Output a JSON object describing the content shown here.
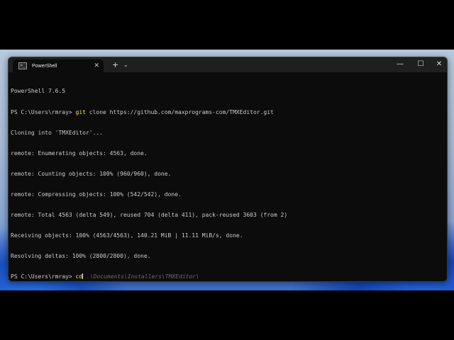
{
  "window": {
    "tab_title": "PowerShell",
    "tab_icon_glyph": ">_",
    "tab_close_glyph": "✕",
    "new_tab_glyph": "+",
    "dropdown_glyph": "⌄",
    "minimize_glyph": "—",
    "maximize_glyph": "☐",
    "close_glyph": "✕"
  },
  "terminal": {
    "banner": "PowerShell 7.6.5",
    "prompt": "PS C:\\Users\\rmray> ",
    "clone_cmd": "git",
    "clone_args": " clone https://github.com/maxprograms-com/TMXEditor.git",
    "output": [
      "Cloning into 'TMXEditor'...",
      "remote: Enumerating objects: 4563, done.",
      "remote: Counting objects: 100% (960/960), done.",
      "remote: Compressing objects: 100% (542/542), done.",
      "remote: Total 4563 (delta 549), reused 704 (delta 411), pack-reused 3603 (from 2)",
      "Receiving objects: 100% (4563/4563), 140.21 MiB | 11.11 MiB/s, done.",
      "Resolving deltas: 100% (2800/2800), done."
    ],
    "current_cmd": "cd",
    "suggestion": " .\\Documents\\Installers\\TMXEditor\\"
  },
  "colors": {
    "terminal_bg": "#0c0c0c",
    "titlebar_bg": "#1f1f1f",
    "command_yellow": "#f2e36a",
    "suggestion_gray": "#6a6a6a"
  }
}
